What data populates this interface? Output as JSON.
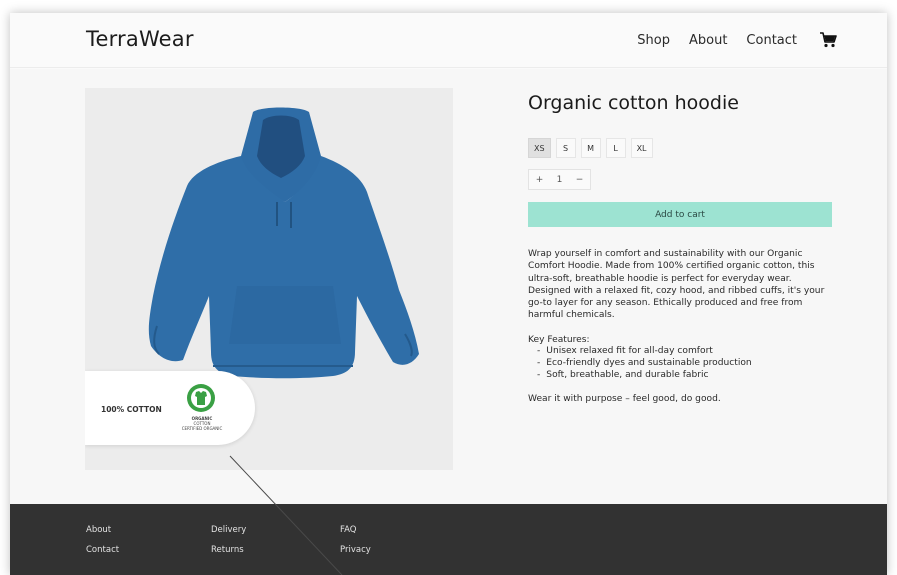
{
  "brand": {
    "name": "TerraWear"
  },
  "nav": {
    "items": [
      "Shop",
      "About",
      "Contact"
    ]
  },
  "product": {
    "title": "Organic cotton hoodie",
    "sizes": [
      "XS",
      "S",
      "M",
      "L",
      "XL"
    ],
    "selected_size": "XS",
    "quantity": {
      "decrement": "+",
      "value": "1",
      "increment": "−"
    },
    "add_to_cart": "Add to cart",
    "description": "Wrap yourself in comfort and sustainability with our Organic Comfort Hoodie. Made from 100% certified organic cotton, this ultra-soft, breathable hoodie is perfect for everyday wear. Designed with a relaxed fit, cozy hood, and ribbed cuffs, it's your go-to layer for any season. Ethically produced and free from harmful chemicals.",
    "features_title": "Key Features:",
    "features": [
      "Unisex relaxed fit for all-day comfort",
      "Eco-friendly dyes and sustainable production",
      "Soft, breathable, and durable fabric"
    ],
    "tagline": "Wear it with purpose – feel good, do good.",
    "badge": {
      "text": "100% COTTON",
      "line1": "ORGANIC",
      "line2": "COTTON",
      "line3": "CERTIFIED ORGANIC"
    }
  },
  "footer": {
    "col1": [
      "About",
      "Contact"
    ],
    "col2": [
      "Delivery",
      "Returns"
    ],
    "col3": [
      "FAQ",
      "Privacy"
    ]
  },
  "colors": {
    "accent": "#9de3d2",
    "hoodie": "#2f6ea8",
    "footer_bg": "#323232",
    "badge_green": "#3aa044"
  },
  "icons": {
    "cart": "cart-icon",
    "certification": "gots-logo-icon"
  }
}
